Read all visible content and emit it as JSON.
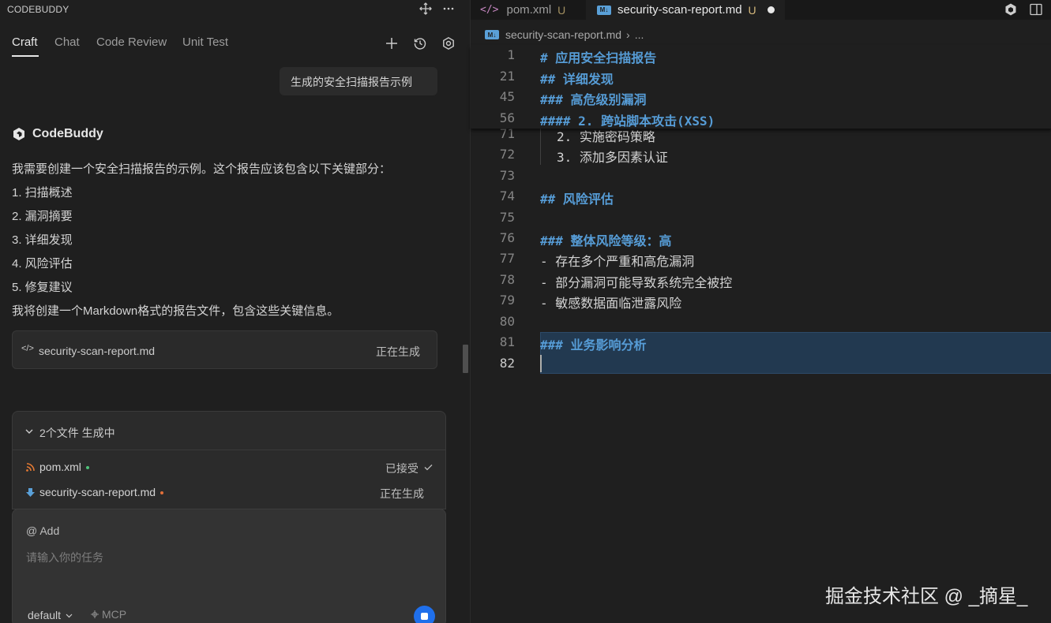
{
  "left_panel": {
    "title": "CODEBUDDY",
    "tabs": [
      {
        "label": "Craft"
      },
      {
        "label": "Chat"
      },
      {
        "label": "Code Review"
      },
      {
        "label": "Unit Test"
      }
    ],
    "user_message": "生成的安全扫描报告示例",
    "bot_name": "CodeBuddy",
    "bot_message": [
      "我需要创建一个安全扫描报告的示例。这个报告应该包含以下关键部分：",
      "1. 扫描概述",
      "2. 漏洞摘要",
      "3. 详细发现",
      "4. 风险评估",
      "5. 修复建议",
      "我将创建一个Markdown格式的报告文件，包含这些关键信息。"
    ],
    "file_card": {
      "filename": "security-scan-report.md",
      "status": "正在生成"
    },
    "generation": {
      "title": "2个文件 生成中",
      "files": [
        {
          "name": "pom.xml",
          "status": "已接受"
        },
        {
          "name": "security-scan-report.md",
          "status": "正在生成"
        }
      ]
    },
    "input": {
      "add_label": "@ Add",
      "placeholder": "请输入你的任务",
      "mode": "default",
      "mcp_label": "MCP"
    }
  },
  "editor": {
    "tabs": [
      {
        "label": "pom.xml",
        "badge": "U"
      },
      {
        "label": "security-scan-report.md",
        "badge": "U"
      }
    ],
    "breadcrumb": {
      "file": "security-scan-report.md",
      "rest": "..."
    },
    "sticky_lines": [
      {
        "num": "1",
        "text": "# 应用安全扫描报告"
      },
      {
        "num": "21",
        "text": "## 详细发现"
      },
      {
        "num": "45",
        "text": "### 高危级别漏洞"
      },
      {
        "num": "56",
        "text": "#### 2. 跨站脚本攻击(XSS)"
      }
    ],
    "lines": [
      {
        "num": "71",
        "text": "2. 实施密码策略"
      },
      {
        "num": "72",
        "text": "3. 添加多因素认证"
      },
      {
        "num": "73",
        "text": ""
      },
      {
        "num": "74",
        "text": "## 风险评估"
      },
      {
        "num": "75",
        "text": ""
      },
      {
        "num": "76",
        "text": "### 整体风险等级：高"
      },
      {
        "num": "77",
        "text": "- 存在多个严重和高危漏洞"
      },
      {
        "num": "78",
        "text": "- 部分漏洞可能导致系统完全被控"
      },
      {
        "num": "79",
        "text": "- 敏感数据面临泄露风险"
      },
      {
        "num": "80",
        "text": ""
      },
      {
        "num": "81",
        "text": "### 业务影响分析"
      },
      {
        "num": "82",
        "text": ""
      }
    ]
  },
  "watermark": "掘金技术社区 @ _摘星_",
  "colors": {
    "accent": "#1f6feb",
    "heading": "#569cd6",
    "untracked": "#d7ba7d"
  }
}
